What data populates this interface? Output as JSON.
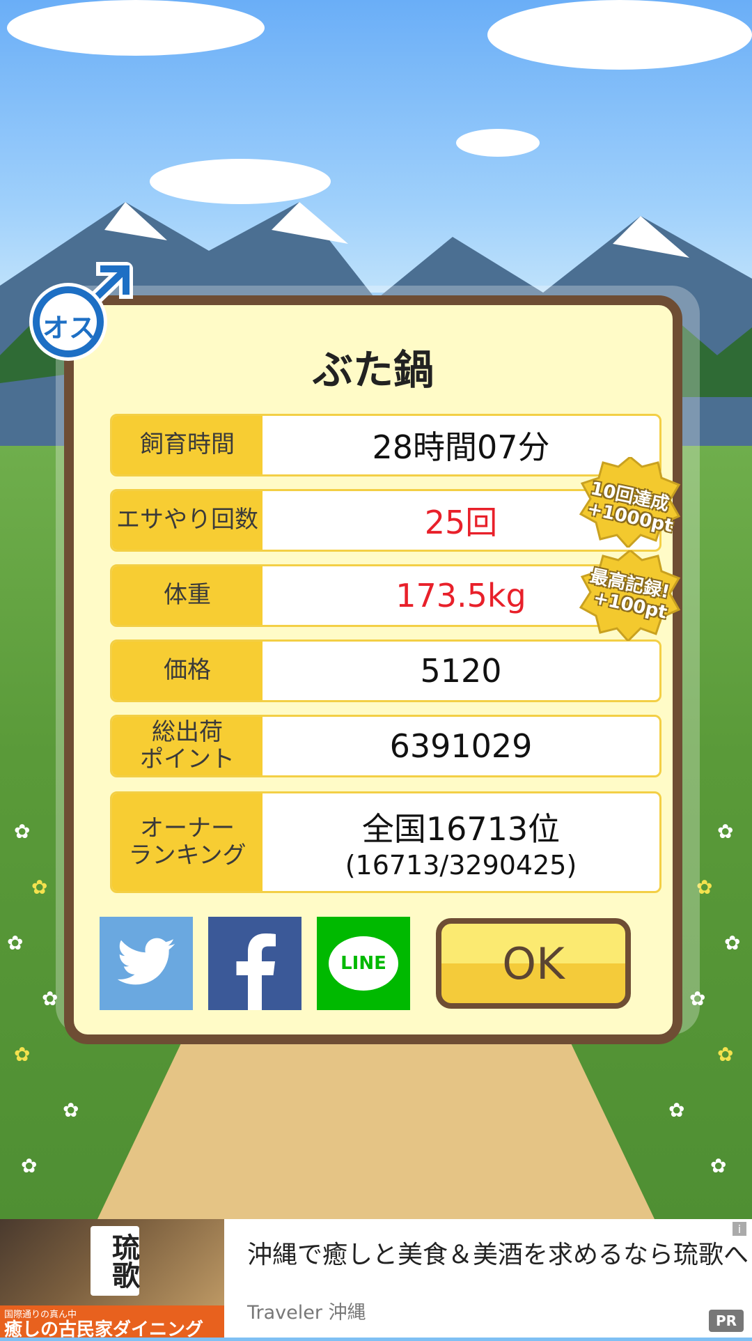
{
  "sex_badge": {
    "label": "オス"
  },
  "pig_name": "ぶた鍋",
  "stats": [
    {
      "label": "飼育時間",
      "value": "28時間07分",
      "highlight": false
    },
    {
      "label": "エサやり回数",
      "value": "25回",
      "highlight": true
    },
    {
      "label": "体重",
      "value": "173.5kg",
      "highlight": true
    },
    {
      "label": "価格",
      "value": "5120",
      "highlight": false
    },
    {
      "label": "総出荷\nポイント",
      "value": "6391029",
      "highlight": false
    },
    {
      "label": "オーナー\nランキング",
      "value": "全国16713位",
      "sub": "(16713/3290425)",
      "highlight": false
    }
  ],
  "bonuses": [
    {
      "line1": "10回達成",
      "line2": "+1000pt"
    },
    {
      "line1": "最高記録!",
      "line2": "+100pt"
    }
  ],
  "share": {
    "twitter_icon": "twitter-bird-icon",
    "facebook_icon": "facebook-f-icon",
    "line_label": "LINE"
  },
  "ok_label": "OK",
  "ad": {
    "image_small": "国際通りの真ん中",
    "image_big": "癒しの古民家ダイニング",
    "image_logo": "琉歌",
    "headline": "沖縄で癒しと美食＆美酒を求めるなら琉歌へ",
    "source": "Traveler 沖縄",
    "pr_label": "PR",
    "info_label": "i"
  },
  "colors": {
    "frame": "#6e4d34",
    "panel": "#fffbc7",
    "label_bg": "#f7cd33",
    "highlight_text": "#e8202a",
    "twitter": "#6aa8e0",
    "facebook": "#3b5998",
    "line": "#00b900"
  }
}
